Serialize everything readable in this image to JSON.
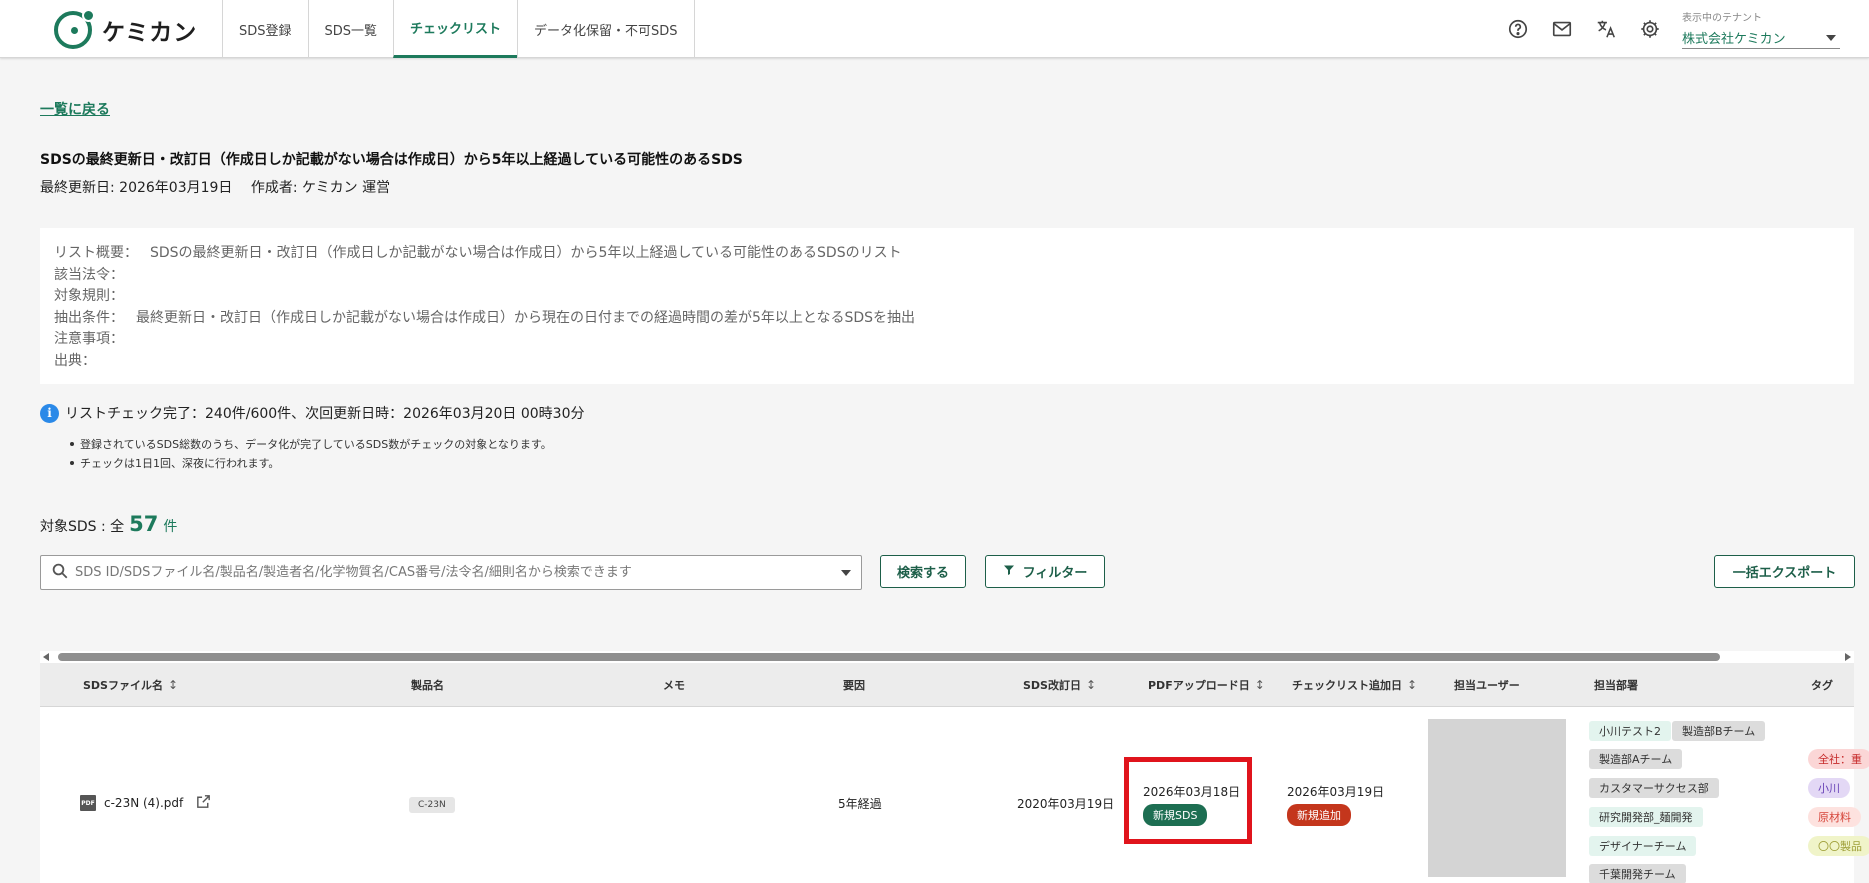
{
  "header": {
    "logo_text": "ケミカン",
    "nav": [
      {
        "label": "SDS登録"
      },
      {
        "label": "SDS一覧"
      },
      {
        "label": "チェックリスト"
      },
      {
        "label": "データ化保留・不可SDS"
      }
    ],
    "active_tab": "チェックリスト",
    "icons": [
      "help-icon",
      "mail-icon",
      "translate-icon",
      "gear-icon"
    ],
    "tenant_caption": "表示中のテナント",
    "tenant_value": "株式会社ケミカン"
  },
  "back_link": "一覧に戻る",
  "title": "SDSの最終更新日・改訂日（作成日しか記載がない場合は作成日）から5年以上経過している可能性のあるSDS",
  "meta": {
    "updated": "最終更新日: 2026年03月19日",
    "author": "作成者: ケミカン 運営"
  },
  "summary": [
    {
      "key": "リスト概要：",
      "value": "SDSの最終更新日・改訂日（作成日しか記載がない場合は作成日）から5年以上経過している可能性のあるSDSのリスト"
    },
    {
      "key": "該当法令：",
      "value": ""
    },
    {
      "key": "対象規則：",
      "value": ""
    },
    {
      "key": "抽出条件：",
      "value": "最終更新日・改訂日（作成日しか記載がない場合は作成日）から現在の日付までの経過時間の差が5年以上となるSDSを抽出"
    },
    {
      "key": "注意事項：",
      "value": ""
    },
    {
      "key": "出典：",
      "value": ""
    }
  ],
  "notice": {
    "text": "リストチェック完了：240件/600件、次回更新日時：2026年03月20日 00時30分",
    "bullets": [
      "登録されているSDS総数のうち、データ化が完了しているSDS数がチェックの対象となります。",
      "チェックは1日1回、深夜に行われます。"
    ]
  },
  "count": {
    "prefix": "対象SDS : 全",
    "number": "57",
    "suffix": "件"
  },
  "search": {
    "placeholder": "SDS ID/SDSファイル名/製品名/製造者名/化学物質名/CAS番号/法令名/細則名から検索できます",
    "value": ""
  },
  "buttons": {
    "search": "検索する",
    "filter": "フィルター",
    "export": "一括エクスポート"
  },
  "table": {
    "columns": [
      "SDSファイル名",
      "製品名",
      "メモ",
      "要因",
      "SDS改訂日",
      "PDFアップロード日",
      "チェックリスト追加日",
      "担当ユーザー",
      "担当部署",
      "タグ"
    ],
    "rows": [
      {
        "file_name": "c-23N (4).pdf",
        "pdf_label": "PDF",
        "product": "C-23N",
        "memo": "",
        "reason": "5年経過",
        "revision_date": "2020年03月19日",
        "upload_date": "2026年03月18日",
        "upload_badge": "新規SDS",
        "added_date": "2026年03月19日",
        "added_badge": "新規追加",
        "departments": [
          "小川テスト2",
          "製造部Bチーム",
          "製造部Aチーム",
          "カスタマーサクセス部",
          "研究開発部_麺開発",
          "デザイナーチーム",
          "千葉開発チーム"
        ],
        "tags": [
          "全社：重",
          "小川",
          "原材料",
          "〇〇製品"
        ]
      }
    ]
  },
  "colors": {
    "brand": "#1d7a5c",
    "badge_green": "#1d6e52",
    "badge_red": "#c4361c",
    "highlight": "#e0141c"
  }
}
